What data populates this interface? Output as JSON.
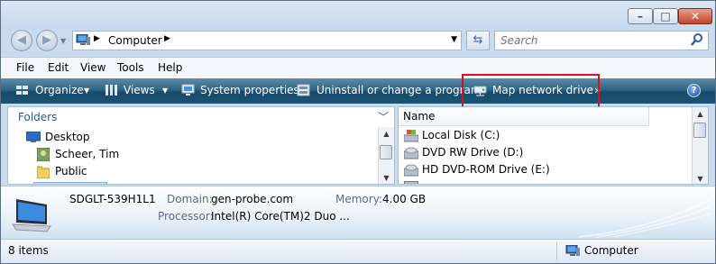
{
  "window": {
    "minimize": "–",
    "maximize": "□",
    "close": "✕"
  },
  "address": {
    "location": "Computer",
    "search_placeholder": "Search"
  },
  "menubar": {
    "items": [
      "File",
      "Edit",
      "View",
      "Tools",
      "Help"
    ]
  },
  "toolbar": {
    "organize": "Organize",
    "views": "Views",
    "system_properties": "System properties",
    "uninstall": "Uninstall or change a program",
    "map_network_drive": "Map network drive",
    "more": "»",
    "help": "?"
  },
  "folders_pane": {
    "header": "Folders",
    "items": [
      "Desktop",
      "Scheer, Tim",
      "Public"
    ]
  },
  "file_list": {
    "column_name": "Name",
    "items": [
      "Local Disk (C:)",
      "DVD RW Drive (D:)",
      "HD DVD-ROM Drive (E:)"
    ]
  },
  "details": {
    "computer_name": "SDGLT-539H1L1",
    "domain_label": "Domain:",
    "domain_value": "gen-probe.com",
    "memory_label": "Memory:",
    "memory_value": "4.00 GB",
    "processor_label": "Processor:",
    "processor_value": "Intel(R) Core(TM)2 Duo ..."
  },
  "statusbar": {
    "item_count": "8 items",
    "location": "Computer"
  },
  "colors": {
    "toolbar": "#1c5373",
    "highlight": "#d4141f",
    "link": "#1e5a9c"
  }
}
